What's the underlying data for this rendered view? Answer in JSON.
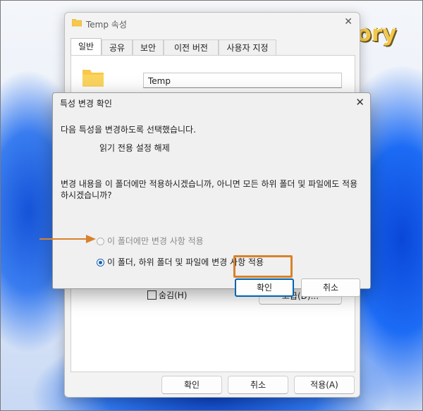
{
  "watermark": "PC story",
  "properties_window": {
    "title": "Temp 속성",
    "tabs": [
      "일반",
      "공유",
      "보안",
      "이전 버전",
      "사용자 지정"
    ],
    "active_tab": "일반",
    "folder_name": "Temp",
    "hidden_checkbox_label": "숨김(H)",
    "advanced_button": "고급(D)...",
    "buttons": {
      "ok": "확인",
      "cancel": "취소",
      "apply": "적용(A)"
    }
  },
  "dialog": {
    "title": "특성 변경 확인",
    "message": "다음 특성을 변경하도록 선택했습니다.",
    "attribute_change": "읽기 전용 설정 해제",
    "question": "변경 내용을 이 폴더에만 적용하시겠습니까, 아니면 모든 하위 폴더 및 파일에도 적용하시겠습니까?",
    "option_folder_only": "이 폴더에만 변경 사항 적용",
    "option_all": "이 폴더, 하위 폴더 및 파일에 변경 사항 적용",
    "selected_option": "option_all",
    "ok_button": "확인",
    "cancel_button": "취소"
  },
  "colors": {
    "accent": "#0063b1",
    "highlight_box": "#d9822b",
    "watermark": "#f3c74a",
    "folder": "#f8c84a"
  }
}
